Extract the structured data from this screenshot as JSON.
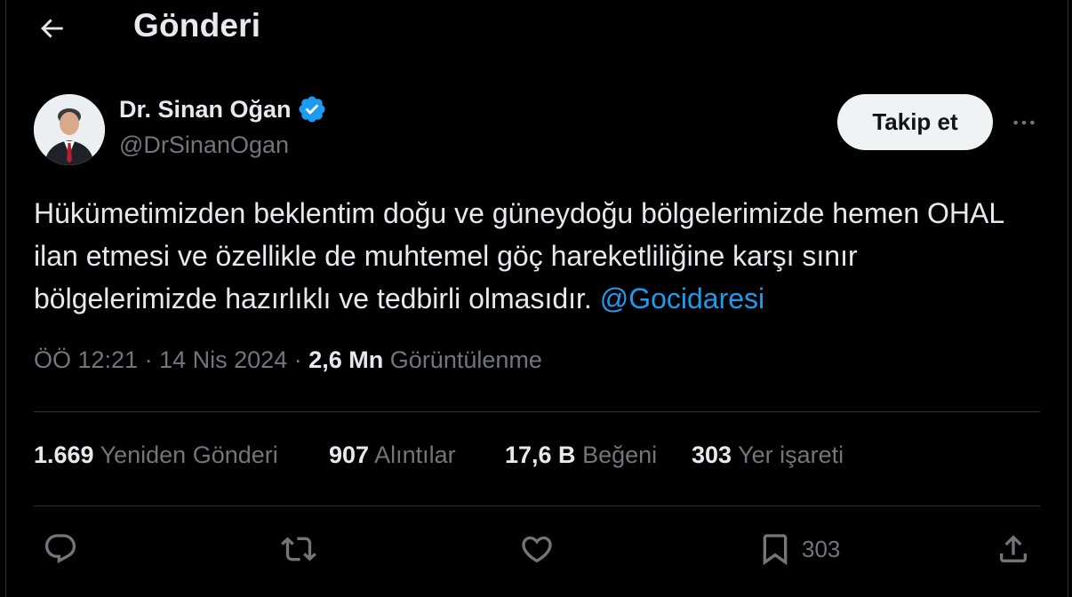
{
  "header": {
    "title": "Gönderi",
    "back_icon": "arrow-left-icon"
  },
  "author": {
    "name": "Dr. Sinan Oğan",
    "handle": "@DrSinanOgan",
    "verified_color": "#1d9bf0"
  },
  "follow_button": "Takip et",
  "tweet": {
    "text": "Hükümetimizden beklentim doğu ve güneydoğu bölgelerimizde hemen OHAL ilan etmesi ve özellikle de muhtemel göç hareketliliğine karşı sınır bölgelerimizde hazırlıklı ve tedbirli olmasıdır.",
    "mention": "@Gocidaresi"
  },
  "meta": {
    "time": "ÖÖ 12:21",
    "separator": "·",
    "date": "14 Nis 2024",
    "views_count": "2,6 Mn",
    "views_label": "Görüntülenme"
  },
  "stats": [
    {
      "count": "1.669",
      "label": "Yeniden Gönderi"
    },
    {
      "count": "907",
      "label": "Alıntılar"
    },
    {
      "count": "17,6 B",
      "label": "Beğeni"
    },
    {
      "count": "303",
      "label": "Yer işareti"
    }
  ],
  "actions": {
    "reply_icon": "reply-icon",
    "retweet_icon": "retweet-icon",
    "like_icon": "heart-icon",
    "bookmark_icon": "bookmark-icon",
    "bookmark_count": "303",
    "share_icon": "share-icon"
  },
  "colors": {
    "background": "#000000",
    "text_primary": "#e7e9ea",
    "text_secondary": "#71767b",
    "accent": "#1d9bf0",
    "divider": "#2f3336"
  }
}
